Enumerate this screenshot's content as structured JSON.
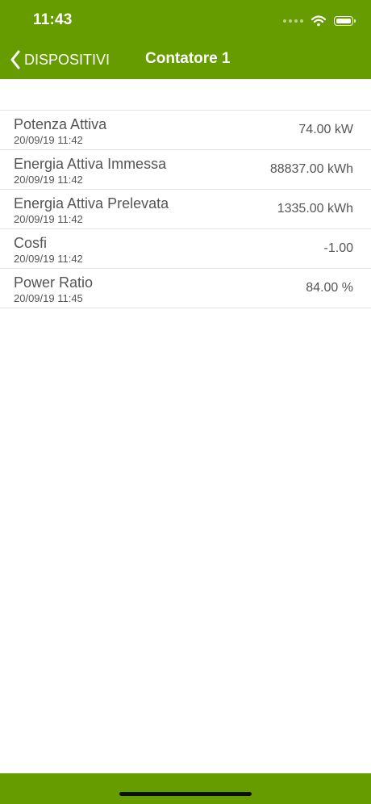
{
  "status_bar": {
    "time": "11:43"
  },
  "nav": {
    "back_label": "DISPOSITIVI",
    "title": "Contatore 1"
  },
  "rows": [
    {
      "title": "Potenza Attiva",
      "date": "20/09/19 11:42",
      "value": "74.00 kW"
    },
    {
      "title": "Energia Attiva Immessa",
      "date": "20/09/19 11:42",
      "value": "88837.00 kWh"
    },
    {
      "title": "Energia Attiva Prelevata",
      "date": "20/09/19 11:42",
      "value": "1335.00 kWh"
    },
    {
      "title": "Cosfi",
      "date": "20/09/19 11:42",
      "value": "-1.00"
    },
    {
      "title": "Power Ratio",
      "date": "20/09/19 11:45",
      "value": "84.00 %"
    }
  ],
  "icons": {
    "back": "chevron-left-icon",
    "wifi": "wifi-icon",
    "battery": "battery-icon",
    "signal": "cellular-signal-icon"
  },
  "colors": {
    "bar_green": "#669c00",
    "text_gray": "#555555",
    "separator": "#e2e2e2"
  }
}
